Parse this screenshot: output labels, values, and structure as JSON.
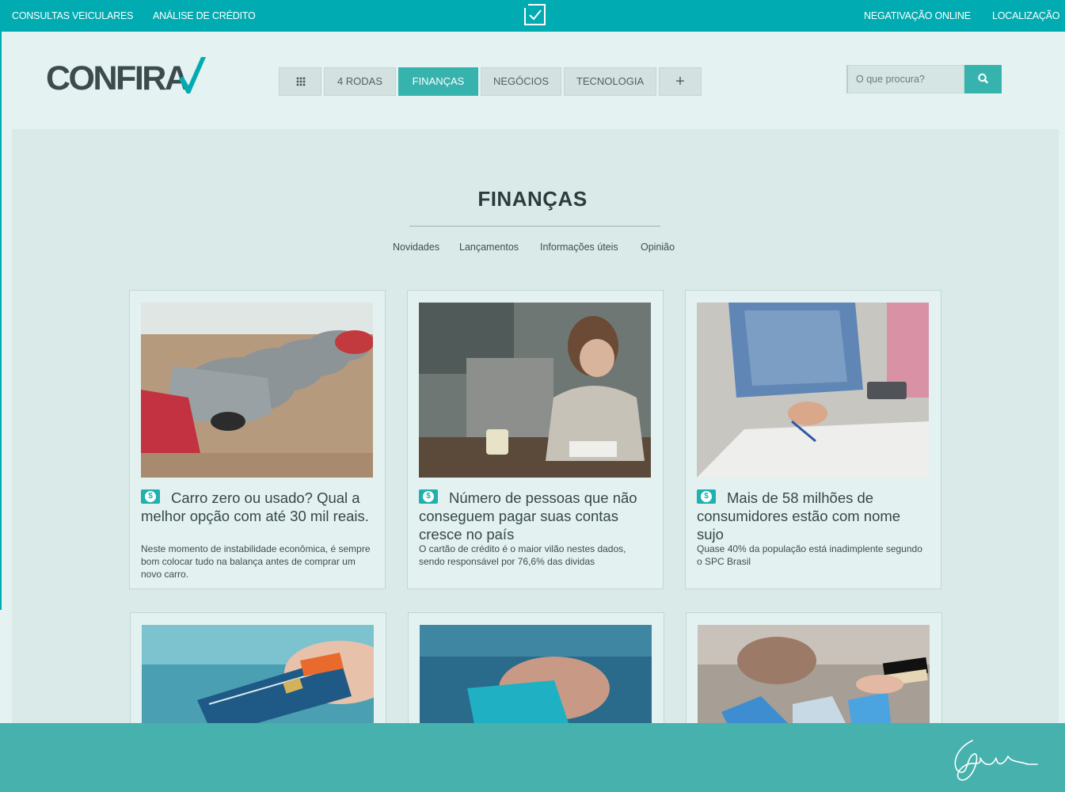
{
  "colors": {
    "brand": "#00abb1",
    "accent": "#37b3ad",
    "footer": "#47b1ad",
    "background": "#e4f3f2"
  },
  "topbar": {
    "links": [
      "CONSULTAS VEICULARES",
      "ANÁLISE DE CRÉDITO",
      "NEGATIVAÇÃO ONLINE",
      "LOCALIZAÇÃO"
    ],
    "center_icon": "checkbox-logo-icon"
  },
  "header": {
    "logo_text": "CONFIRA",
    "nav": [
      {
        "label": "",
        "icon": "grid-menu-icon"
      },
      {
        "label": "4 RODAS"
      },
      {
        "label": "FINANÇAS",
        "active": true
      },
      {
        "label": "NEGÓCIOS"
      },
      {
        "label": "TECNOLOGIA"
      },
      {
        "label": "+",
        "icon": "plus-icon"
      }
    ],
    "search": {
      "placeholder": "O que procura?",
      "icon": "search-icon"
    }
  },
  "section": {
    "title": "FINANÇAS",
    "subnav": [
      "Novidades",
      "Lançamentos",
      "Informações úteis",
      "Opinião"
    ]
  },
  "cards": [
    {
      "icon": "dollar-badge-icon",
      "image": "parked-cars-photo",
      "title": "Carro zero ou usado? Qual a melhor opção com até 30 mil reais.",
      "description": "Neste momento de instabilidade econômica, é sempre bom colocar tudo na balança antes de comprar um novo carro."
    },
    {
      "icon": "dollar-badge-icon",
      "image": "stressed-woman-bills-photo",
      "title": "Número de pessoas que não conseguem pagar suas contas cresce no país",
      "description": "O cartão de crédito é o maior vilão nestes dados, sendo responsável por 76,6% das dividas"
    },
    {
      "icon": "dollar-badge-icon",
      "image": "couple-calculator-bills-photo",
      "title": "Mais de 58 milhões de consumidores estão com nome sujo",
      "description": "Quase 40% da população está inadimplente segundo o SPC Brasil"
    },
    {
      "image": "credit-card-hand-photo"
    },
    {
      "image": "card-payment-photo"
    },
    {
      "image": "shopping-bags-card-photo"
    }
  ],
  "footer": {
    "icon": "signature-logo-icon"
  }
}
